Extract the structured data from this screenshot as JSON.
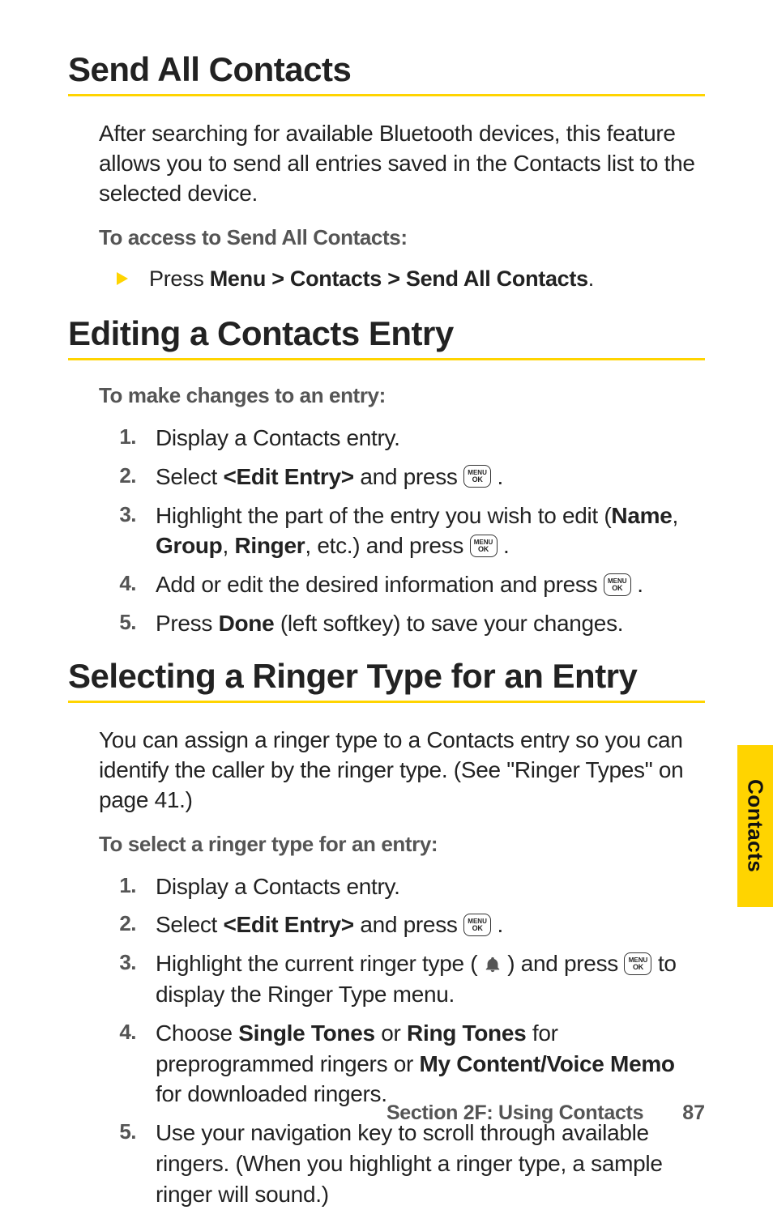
{
  "sideTab": "Contacts",
  "footer": {
    "section": "Section 2F: Using Contacts",
    "page": "87"
  },
  "key": {
    "l1": "MENU",
    "l2": "OK"
  },
  "sec1": {
    "heading": "Send All Contacts",
    "intro": "After searching for available Bluetooth devices, this feature allows you to send all entries saved in the Contacts list to the selected device.",
    "sub": "To access to Send All Contacts:",
    "bullet": {
      "pre": "Press ",
      "bold": "Menu > Contacts > Send All Contacts",
      "post": "."
    }
  },
  "sec2": {
    "heading": "Editing a Contacts Entry",
    "sub": "To make changes to an entry:",
    "s1": "Display a Contacts entry.",
    "s2": {
      "pre": "Select ",
      "bold": "<Edit Entry>",
      "mid": " and press ",
      "post": " ."
    },
    "s3": {
      "pre": "Highlight the part of the entry you wish to edit (",
      "b1": "Name",
      "c1": ", ",
      "b2": "Group",
      "c2": ", ",
      "b3": "Ringer",
      "mid": ", etc.) and press ",
      "post": " ."
    },
    "s4": {
      "pre": "Add or edit the desired information and press ",
      "post": " ."
    },
    "s5": {
      "pre": "Press ",
      "bold": "Done",
      "post": " (left softkey) to save your changes."
    }
  },
  "sec3": {
    "heading": "Selecting a Ringer Type for an Entry",
    "intro": "You can assign a ringer type to a Contacts entry so you can identify the caller by the ringer type. (See \"Ringer Types\" on page 41.)",
    "sub": "To select a ringer type for an entry:",
    "s1": "Display a Contacts entry.",
    "s2": {
      "pre": "Select ",
      "bold": "<Edit Entry>",
      "mid": " and press ",
      "post": " ."
    },
    "s3": {
      "pre": "Highlight the current ringer type ( ",
      "mid": " ) and press ",
      "post": " to display the Ringer Type menu."
    },
    "s4": {
      "pre": "Choose ",
      "b1": "Single Tones",
      "c1": " or ",
      "b2": "Ring Tones",
      "mid": " for preprogrammed ringers or ",
      "b3": "My Content/Voice Memo",
      "post": " for downloaded ringers."
    },
    "s5": "Use your navigation key to scroll through available ringers. (When you highlight a ringer type, a sample ringer will sound.)"
  }
}
